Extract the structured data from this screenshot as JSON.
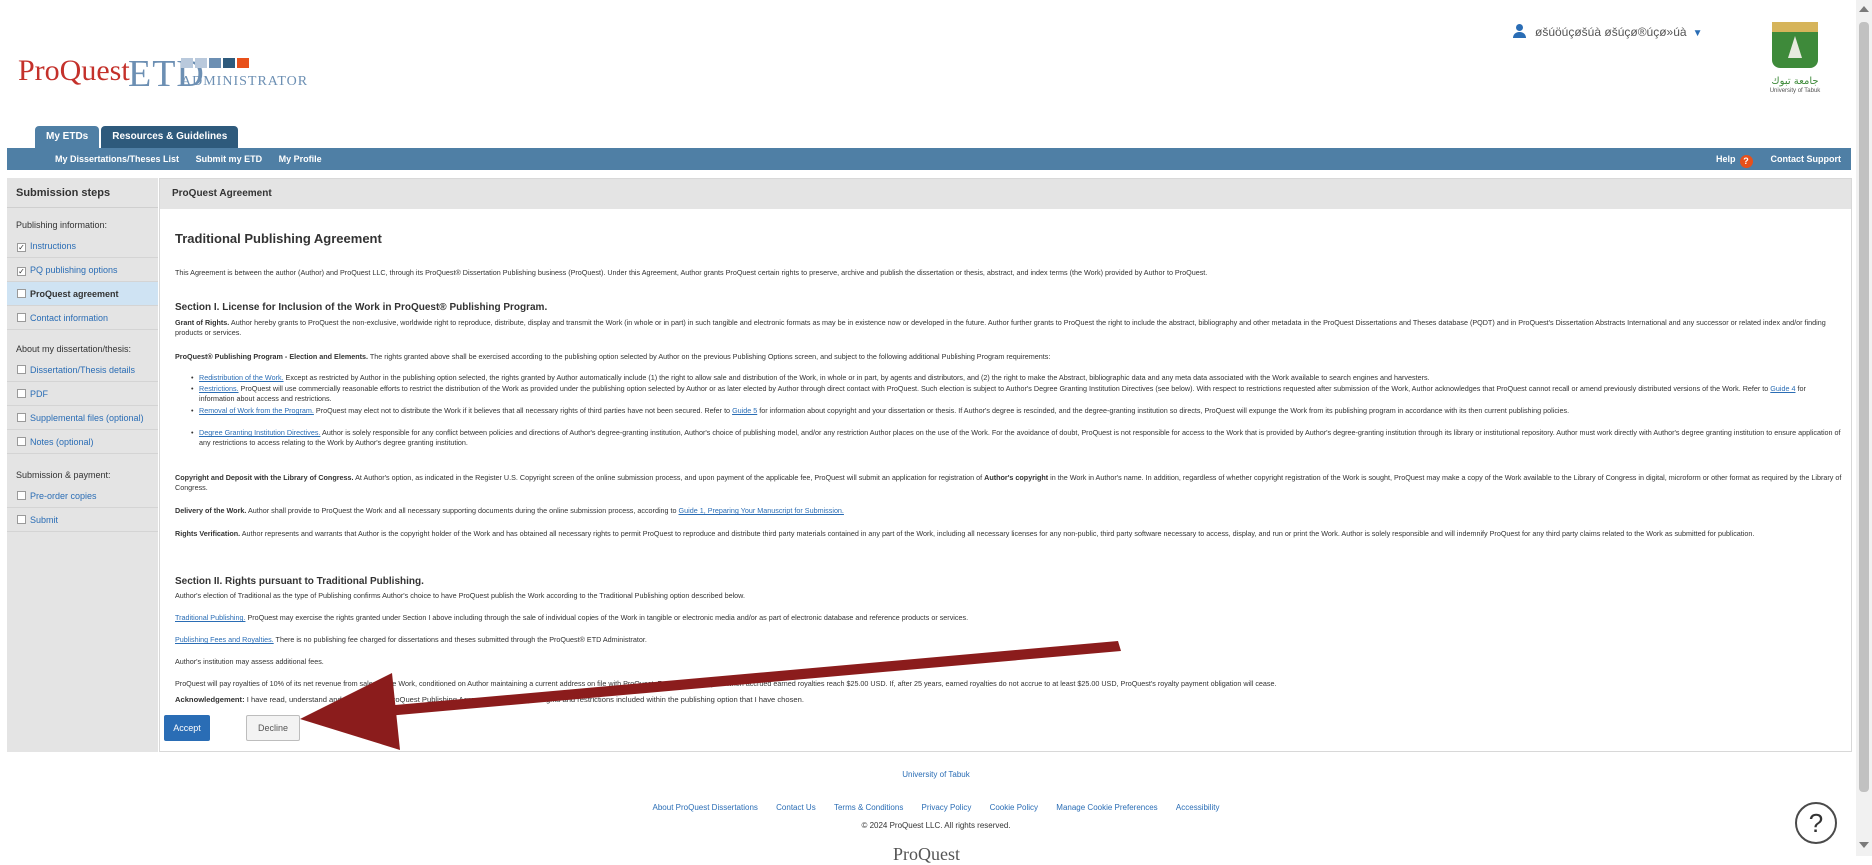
{
  "header": {
    "logo_proquest": "ProQuest",
    "logo_etd": "ETD",
    "logo_administrator": "ADMINISTRATOR",
    "user_name": "øšúöúçøšúà øšúçø®úçø»úà",
    "university_logo_arabic": "جامعة تبوك",
    "university_logo_english": "University of Tabuk"
  },
  "tabs": [
    {
      "label": "My ETDs"
    },
    {
      "label": "Resources & Guidelines"
    }
  ],
  "subnav": {
    "items": [
      "My Dissertations/Theses List",
      "Submit my ETD",
      "My Profile"
    ],
    "help": "Help",
    "contact": "Contact Support"
  },
  "sidebar": {
    "title": "Submission steps",
    "sections": [
      {
        "title": "Publishing information:",
        "items": [
          {
            "label": "Instructions",
            "checked": true
          },
          {
            "label": "PQ publishing options",
            "checked": true
          },
          {
            "label": "ProQuest agreement",
            "checked": false,
            "active": true
          },
          {
            "label": "Contact information",
            "checked": false
          }
        ]
      },
      {
        "title": "About my dissertation/thesis:",
        "items": [
          {
            "label": "Dissertation/Thesis details",
            "checked": false
          },
          {
            "label": "PDF",
            "checked": false
          },
          {
            "label": "Supplemental files (optional)",
            "checked": false
          },
          {
            "label": "Notes (optional)",
            "checked": false
          }
        ]
      },
      {
        "title": "Submission & payment:",
        "items": [
          {
            "label": "Pre-order copies",
            "checked": false
          },
          {
            "label": "Submit",
            "checked": false
          }
        ]
      }
    ]
  },
  "main": {
    "panel_title": "ProQuest Agreement",
    "agreement_title": "Traditional Publishing Agreement",
    "intro": "This Agreement is between the author (Author) and ProQuest LLC, through its ProQuest® Dissertation Publishing business (ProQuest). Under this Agreement, Author grants ProQuest certain rights to preserve, archive and publish the dissertation or thesis, abstract, and index terms (the Work) provided by Author to ProQuest.",
    "section1_heading": "Section I. License for Inclusion of the Work in ProQuest® Publishing Program.",
    "grant_label": "Grant of Rights.",
    "grant_text": " Author hereby grants to ProQuest the non-exclusive, worldwide right to reproduce, distribute, display and transmit the Work (in whole or in part) in such tangible and electronic formats as may be in existence now or developed in the future. Author further grants to ProQuest the right to include the abstract, bibliography and other metadata in the ProQuest Dissertations and Theses database (PQDT) and in ProQuest's Dissertation Abstracts International and any successor or related index and/or finding products or services.",
    "program_label": "ProQuest® Publishing Program - Election and Elements.",
    "program_text": " The rights granted above shall be exercised according to the publishing option selected by Author on the previous Publishing Options screen, and subject to the following additional Publishing Program requirements:",
    "bullets": [
      {
        "label": "Redistribution of the Work.",
        "text": " Except as restricted by Author in the publishing option selected, the rights granted by Author automatically include (1) the right to allow sale and distribution of the Work, in whole or in part, by agents and distributors, and (2) the right to make the Abstract, bibliographic data and any meta data associated with the Work available to search engines and harvesters."
      },
      {
        "label": "Restrictions.",
        "text": " ProQuest will use commercially reasonable efforts to restrict the distribution of the Work as provided under the publishing option selected by Author or as later elected by Author through direct contact with ProQuest. Such election is subject to Author's Degree Granting Institution Directives (see below). With respect to restrictions requested after submission of the Work, Author acknowledges that ProQuest cannot recall or amend previously distributed versions of the Work. Refer to ",
        "link": "Guide 4",
        "tail": " for information about access and restrictions."
      },
      {
        "label": "Removal of Work from the Program.",
        "text": " ProQuest may elect not to distribute the Work if it believes that all necessary rights of third parties have not been secured. Refer to ",
        "link": "Guide 5",
        "tail": " for information about copyright and your dissertation or thesis. If Author's degree is rescinded, and the degree-granting institution so directs, ProQuest will expunge the Work from its publishing program in accordance with its then current publishing policies."
      },
      {
        "label": "Degree Granting Institution Directives.",
        "text": " Author is solely responsible for any conflict between policies and directions of Author's degree-granting institution, Author's choice of publishing model, and/or any restriction Author places on the use of the Work. For the avoidance of doubt, ProQuest is not responsible for access to the Work that is provided by Author's degree-granting institution through its library or institutional repository. Author must work directly with Author's degree granting institution to ensure application of any restrictions to access relating to the Work by Author's degree granting institution."
      }
    ],
    "copyright_label": "Copyright and Deposit with the Library of Congress.",
    "copyright_text": " At Author's option, as indicated in the Register U.S. Copyright screen of the online submission process, and upon payment of the applicable fee, ProQuest will submit an application for registration of ",
    "copyright_bold": "Author's copyright",
    "copyright_tail": " in the Work in Author's name. In addition, regardless of whether copyright registration of the Work is sought, ProQuest may make a copy of the Work available to the Library of Congress in digital, microform or other format as required by the Library of Congress.",
    "delivery_label": "Delivery of the Work.",
    "delivery_text": " Author shall provide to ProQuest the Work and all necessary supporting documents during the online submission process, according to ",
    "delivery_link": "Guide 1, Preparing Your Manuscript for Submission.",
    "rights_label": "Rights Verification.",
    "rights_text": " Author represents and warrants that Author is the copyright holder of the Work and has obtained all necessary rights to permit ProQuest to reproduce and distribute third party materials contained in any part of the Work, including all necessary licenses for any non-public, third party software necessary to access, display, and run or print the Work. Author is solely responsible and will indemnify ProQuest for any third party claims related to the Work as submitted for publication.",
    "section2_heading": "Section II. Rights pursuant to Traditional Publishing.",
    "section2_intro": "Author's election of Traditional as the type of Publishing confirms Author's choice to have ProQuest publish the Work according to the Traditional Publishing option described below.",
    "traditional_label": "Traditional Publishing.",
    "traditional_text": " ProQuest may exercise the rights granted under Section I above including through the sale of individual copies of the Work in tangible or electronic media and/or as part of electronic database and reference products or services.",
    "fees_label": "Publishing Fees and Royalties.",
    "fees_text": " There is no publishing fee charged for dissertations and theses submitted through the ProQuest® ETD Administrator.",
    "institution_text": "Author's institution may assess additional fees.",
    "royalty_text": "ProQuest will pay royalties of 10% of its net revenue from sales of the Work, conditioned on Author maintaining a current address on file with ProQuest. Royalties will be paid when accrued earned royalties reach $25.00 USD. If, after 25 years, earned royalties do not accrue to at least $25.00 USD, ProQuest's royalty payment obligation will cease.",
    "ack_label": "Acknowledgement:",
    "ack_text": " I have read, understand and agree to this ProQuest Publishing Agreement, including all rights and restrictions included within the publishing option that I have chosen.",
    "accept_label": "Accept",
    "decline_label": "Decline"
  },
  "footer": {
    "university_link": "University of Tabuk",
    "links": [
      "About ProQuest Dissertations",
      "Contact Us",
      "Terms & Conditions",
      "Privacy Policy",
      "Cookie Policy",
      "Manage Cookie Preferences",
      "Accessibility"
    ],
    "copyright": "© 2024 ProQuest LLC. All rights reserved.",
    "logo": "ProQuest",
    "help_icon_glyph": "?"
  },
  "colors": {
    "nav_blue": "#4f7fa5",
    "dark_tab": "#2e5a7c",
    "link_blue": "#2a6db5",
    "accept_blue": "#2a6db5",
    "arrow_red": "#8b1c1c",
    "help_orange": "#e8501a"
  }
}
